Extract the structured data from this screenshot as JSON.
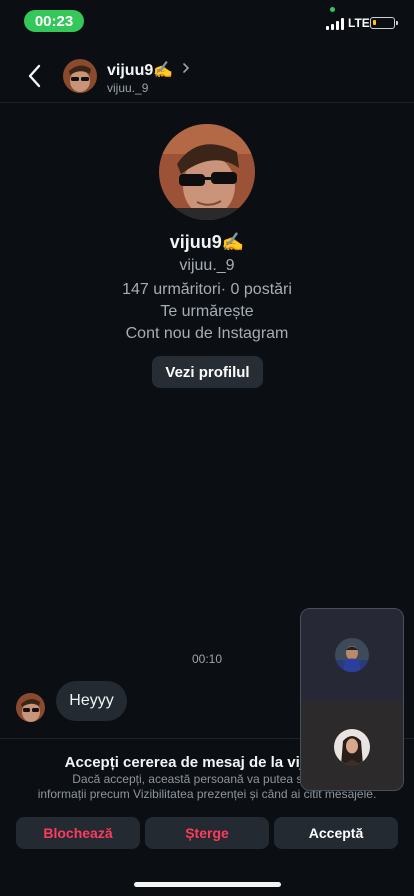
{
  "status_bar": {
    "time": "00:23",
    "network": "LTE",
    "battery_level": 0.12,
    "time_pill_color": "#34c759"
  },
  "header": {
    "back_icon": "chevron-left-icon",
    "display_name": "vijuu9✍️",
    "username": "vijuu._9",
    "chevron_icon": "chevron-right-icon"
  },
  "profile": {
    "display_name": "vijuu9✍️",
    "username": "vijuu._9",
    "stats": "147 urmăritori· 0 postări",
    "follows_you": "Te urmărește",
    "account_note": "Cont nou de Instagram",
    "view_profile_label": "Vezi profilul"
  },
  "chat": {
    "timestamp": "00:10",
    "messages": [
      {
        "text": "Heyyy"
      }
    ]
  },
  "request": {
    "title": "Accepți cererea de mesaj de la vijuu9✍️",
    "body_line1": "Dacă accepți, această persoană va putea să te s...",
    "body_line2": "informații precum Vizibilitatea prezenței și când ai citit mesajele.",
    "block_label": "Blochează",
    "delete_label": "Șterge",
    "accept_label": "Acceptă"
  },
  "pip": {
    "icon": "video-call-overlay"
  },
  "colors": {
    "background": "#0b0f14",
    "button_bg": "#232a31",
    "danger": "#ff3b5c",
    "secondary_text": "#a5adb5"
  }
}
